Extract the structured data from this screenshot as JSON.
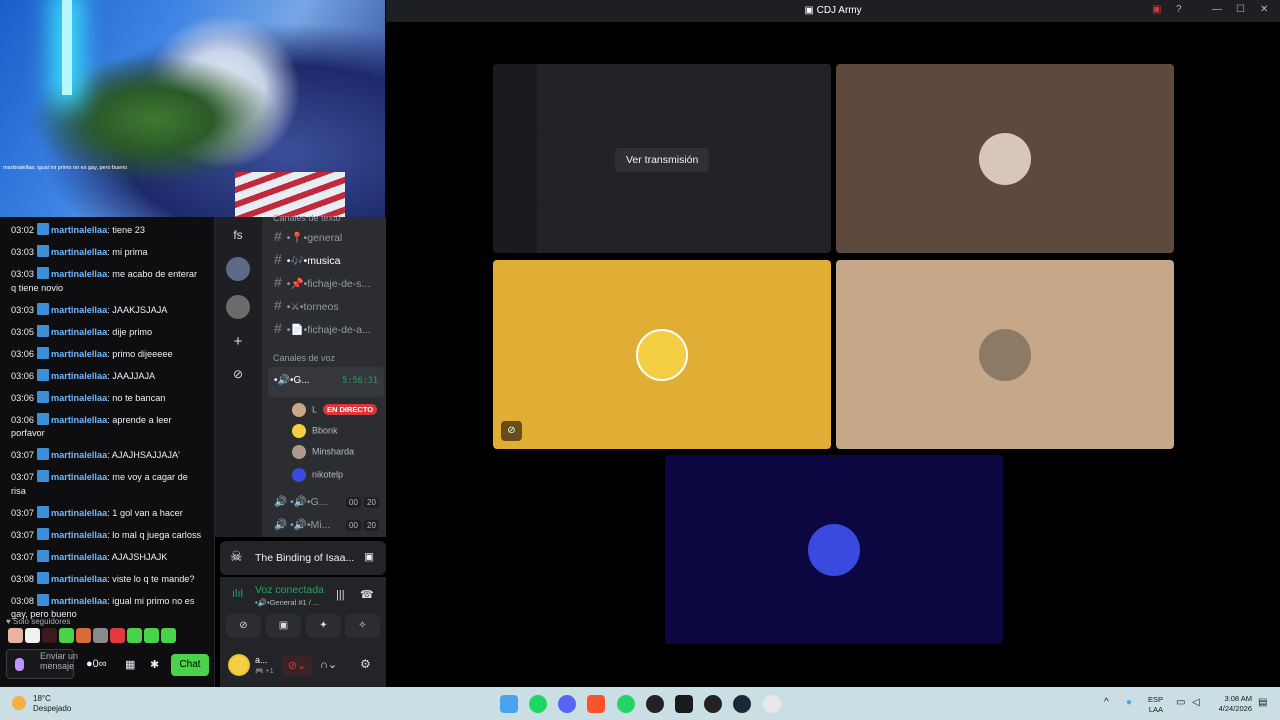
{
  "webcam": {
    "overlay_text": "martinalellaa: igual mi primo no es gay, pero bueno"
  },
  "chat": {
    "messages": [
      {
        "time": "03:02",
        "user": "martinalellaa",
        "text": "tiene 23"
      },
      {
        "time": "03:03",
        "user": "martinalellaa",
        "text": "mi prima"
      },
      {
        "time": "03:03",
        "user": "martinalellaa",
        "text": "me acabo de enterar q tiene novio"
      },
      {
        "time": "03:03",
        "user": "martinalellaa",
        "text": "JAAKJSJAJA"
      },
      {
        "time": "03:05",
        "user": "martinalellaa",
        "text": "dije primo"
      },
      {
        "time": "03:06",
        "user": "martinalellaa",
        "text": "primo dijeeeee"
      },
      {
        "time": "03:06",
        "user": "martinalellaa",
        "text": "JAAJJAJA"
      },
      {
        "time": "03:06",
        "user": "martinalellaa",
        "text": "no te bancan"
      },
      {
        "time": "03:06",
        "user": "martinalellaa",
        "text": "aprende a leer porfavor"
      },
      {
        "time": "03:07",
        "user": "martinalellaa",
        "text": "AJAJHSAJJAJA'"
      },
      {
        "time": "03:07",
        "user": "martinalellaa",
        "text": "me voy a cagar de risa"
      },
      {
        "time": "03:07",
        "user": "martinalellaa",
        "text": "1 gol van a hacer"
      },
      {
        "time": "03:07",
        "user": "martinalellaa",
        "text": "lo mal q juega carloss"
      },
      {
        "time": "03:07",
        "user": "martinalellaa",
        "text": "AJAJSHJAJK"
      },
      {
        "time": "03:08",
        "user": "martinalellaa",
        "text": "viste lo q te mande?"
      },
      {
        "time": "03:08",
        "user": "martinalellaa",
        "text": "igual mi primo no es gay, pero bueno"
      }
    ],
    "followers_only": "Solo seguidores",
    "input_placeholder": "Enviar un mensaje",
    "chat_button": "Chat",
    "bits": "0",
    "emote_colors": [
      "#e8b4a0",
      "#f0f0f0",
      "#3a1a1a",
      "#4bd24b",
      "#d96a3a",
      "#8a8a8a",
      "#e03a3a",
      "#4bd24b",
      "#4bd24b",
      "#4bd24b"
    ]
  },
  "discord": {
    "server_label": "fs",
    "categories": {
      "text": "Canales de texto",
      "voice": "Canales de voz"
    },
    "text_channels": [
      {
        "label": "•📍•general",
        "active": false
      },
      {
        "label": "•🎶•musica",
        "active": true
      },
      {
        "label": "•📌•fichaje-de-s...",
        "active": false
      },
      {
        "label": "•⚔•torneos",
        "active": false
      },
      {
        "label": "•📄•fichaje-de-a...",
        "active": false
      }
    ],
    "voice_channels": [
      {
        "label": "•🔊•G...",
        "timer": "5:56:31"
      },
      {
        "label": "•🔊•G...",
        "c1": "00",
        "c2": "20"
      },
      {
        "label": "•🔊•Mi...",
        "c1": "00",
        "c2": "20"
      }
    ],
    "voice_users": [
      {
        "name": "L",
        "live": "EN DIRECTO",
        "color": "#c9a98a"
      },
      {
        "name": "Bbonk",
        "color": "#f4cf43"
      },
      {
        "name": "Minsharda",
        "color": "#b0998a"
      },
      {
        "name": "nikotelp",
        "color": "#3a4adf"
      }
    ],
    "activity": "The Binding of Isaa...",
    "voice_status": "Voz conectada",
    "voice_channel": "•🔊•General #1 / ...",
    "user": {
      "name": "a...",
      "sub": "🎮 +1"
    }
  },
  "app": {
    "title": "CDJ Army",
    "watch_stream": "Ver transmisión"
  },
  "tiles": [
    {
      "id": "stream"
    },
    {
      "id": "user2",
      "bg": "#5e4a3c",
      "avatar": "#d8c6b8"
    },
    {
      "id": "bbonk",
      "bg": "#e0ad35",
      "avatar": "#f4cf43"
    },
    {
      "id": "cat",
      "bg": "#c6a889",
      "avatar": "#8c7a66"
    },
    {
      "id": "niko",
      "bg": "#0c0740",
      "avatar": "#3a4adf"
    }
  ],
  "taskbar": {
    "temp": "18°C",
    "condition": "Despejado",
    "lang1": "ESP",
    "lang2": "LAA",
    "time": "3:08 AM",
    "date": "4/24/2026"
  }
}
